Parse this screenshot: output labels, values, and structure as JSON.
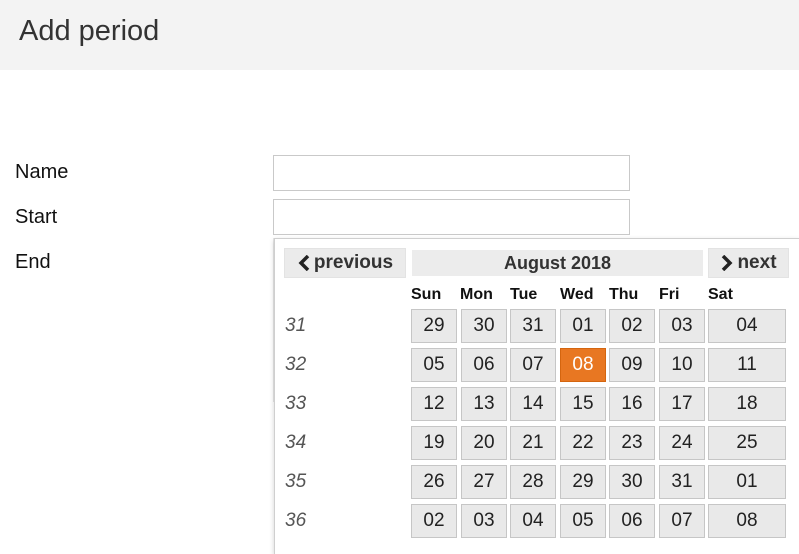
{
  "header": {
    "title": "Add period"
  },
  "form": {
    "name_label": "Name",
    "start_label": "Start",
    "end_label": "End",
    "name_value": "",
    "start_value": ""
  },
  "datepicker": {
    "prev_label": "previous",
    "next_label": "next",
    "month_title": "August 2018",
    "weekdays": [
      "Sun",
      "Mon",
      "Tue",
      "Wed",
      "Thu",
      "Fri",
      "Sat"
    ],
    "weeks": [
      {
        "number": "31",
        "days": [
          "29",
          "30",
          "31",
          "01",
          "02",
          "03",
          "04"
        ]
      },
      {
        "number": "32",
        "days": [
          "05",
          "06",
          "07",
          "08",
          "09",
          "10",
          "11"
        ]
      },
      {
        "number": "33",
        "days": [
          "12",
          "13",
          "14",
          "15",
          "16",
          "17",
          "18"
        ]
      },
      {
        "number": "34",
        "days": [
          "19",
          "20",
          "21",
          "22",
          "23",
          "24",
          "25"
        ]
      },
      {
        "number": "35",
        "days": [
          "26",
          "27",
          "28",
          "29",
          "30",
          "31",
          "01"
        ]
      },
      {
        "number": "36",
        "days": [
          "02",
          "03",
          "04",
          "05",
          "06",
          "07",
          "08"
        ]
      }
    ],
    "highlighted_day": "08",
    "highlight_color": "#e87722"
  },
  "icons": {
    "calendar": "calendar-icon",
    "prev": "chevron-left-icon",
    "next": "chevron-right-icon"
  }
}
